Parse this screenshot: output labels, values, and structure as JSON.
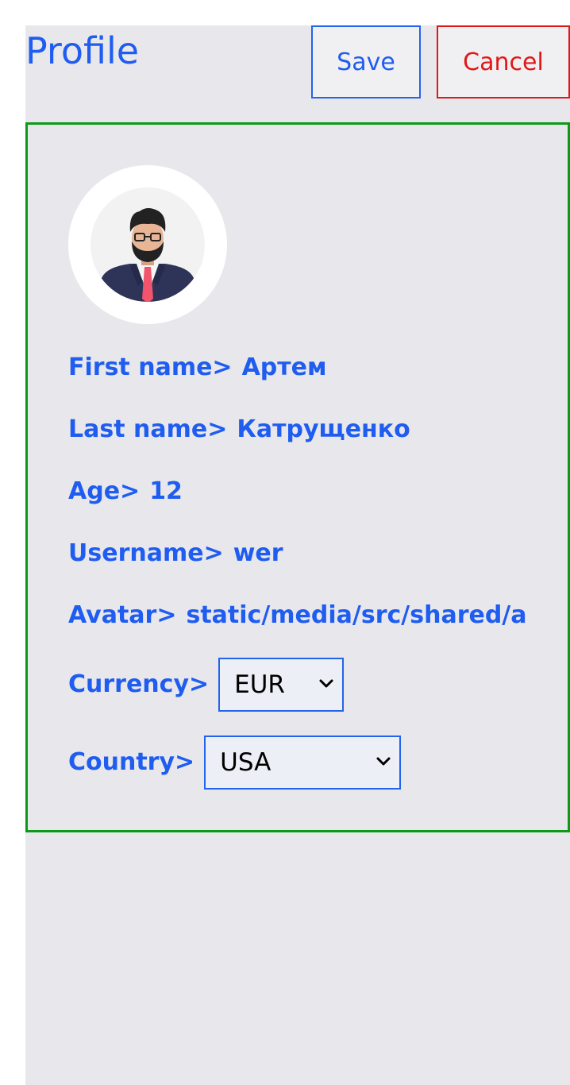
{
  "header": {
    "title": "Profile",
    "save_label": "Save",
    "cancel_label": "Cancel"
  },
  "profile": {
    "first_name": {
      "label": "First name>",
      "value": "Артем"
    },
    "last_name": {
      "label": "Last name>",
      "value": "Катрущенко"
    },
    "age": {
      "label": "Age>",
      "value": "12"
    },
    "username": {
      "label": "Username>",
      "value": "wer"
    },
    "avatar": {
      "label": "Avatar>",
      "value": "static/media/src/shared/ass"
    },
    "currency": {
      "label": "Currency>",
      "selected": "EUR"
    },
    "country": {
      "label": "Country>",
      "selected": "USA"
    }
  },
  "icons": {
    "avatar_image": "man-with-glasses-avatar",
    "currency_dropdown": "chevron-down-icon",
    "country_dropdown": "chevron-down-icon"
  },
  "colors": {
    "accent": "#1f5cf0",
    "save_border": "#2463eb",
    "cancel": "#e01818",
    "card_border": "#0c9a16",
    "background": "#e8e8ec"
  }
}
